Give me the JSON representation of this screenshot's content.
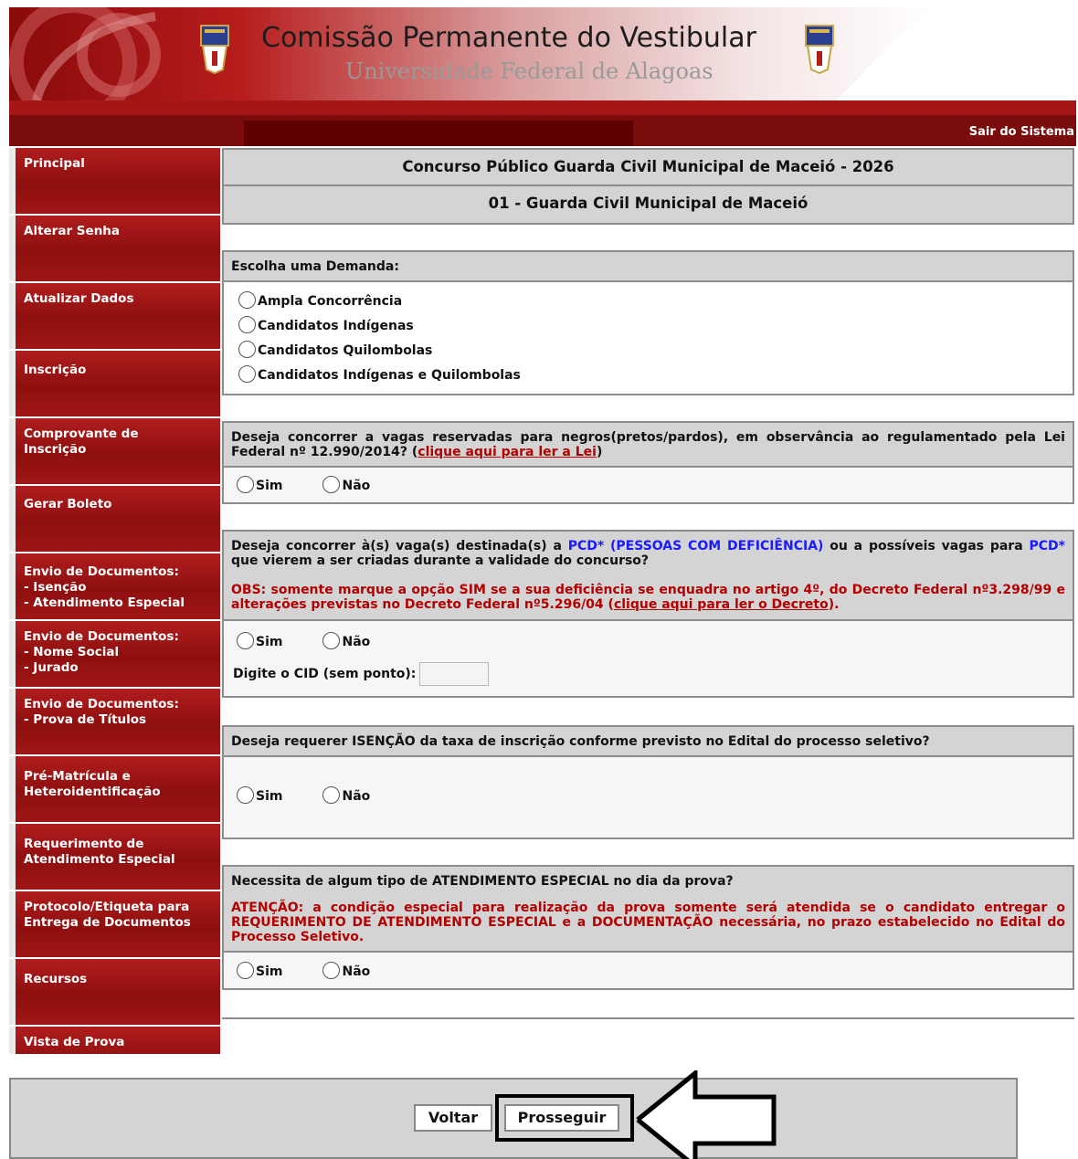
{
  "header": {
    "title": "Comissão Permanente do Vestibular",
    "subtitle": "Universidade Federal de Alagoas",
    "logout_label": "Sair do Sistema",
    "icons": [
      "university-crest-icon"
    ]
  },
  "sidebar": {
    "items": [
      {
        "label": "Principal"
      },
      {
        "label": "Alterar Senha"
      },
      {
        "label": "Atualizar Dados"
      },
      {
        "label": "Inscrição"
      },
      {
        "label": "Comprovante de\nInscrição"
      },
      {
        "label": "Gerar Boleto"
      },
      {
        "label": "Envio de Documentos:\n- Isenção\n- Atendimento Especial"
      },
      {
        "label": "Envio de Documentos:\n- Nome Social\n- Jurado"
      },
      {
        "label": "Envio de Documentos:\n- Prova de Títulos"
      },
      {
        "label": "Pré-Matrícula e\nHeteroidentificação"
      },
      {
        "label": "Requerimento de\nAtendimento Especial"
      },
      {
        "label": "Protocolo/Etiqueta para\nEntrega de Documentos"
      },
      {
        "label": "Recursos"
      },
      {
        "label": "Vista de Prova"
      }
    ]
  },
  "main": {
    "contest_title": "Concurso Público Guarda Civil Municipal de Maceió - 2026",
    "position_title": "01 - Guarda Civil Municipal de Maceió",
    "demand": {
      "heading": "Escolha uma Demanda:",
      "options": [
        "Ampla Concorrência",
        "Candidatos Indígenas",
        "Candidatos Quilombolas",
        "Candidatos Indígenas e Quilombolas"
      ]
    },
    "q_negros": {
      "text": "Deseja concorrer a vagas reservadas para negros(pretos/pardos), em observância ao regulamentado pela Lei Federal nº 12.990/2014? (",
      "link": "clique aqui para ler a Lei",
      "tail": ")",
      "yes": "Sim",
      "no": "Não"
    },
    "q_pcd": {
      "text_a": "Deseja concorrer à(s) vaga(s) destinada(s) a ",
      "pcd_full": "PCD* (PESSOAS COM DEFICIÊNCIA)",
      "text_b": " ou a possíveis vagas para ",
      "pcd_short": "PCD*",
      "text_c": " que vierem a ser criadas durante a validade do concurso?",
      "obs": "OBS: somente marque a opção SIM se a sua deficiência se enquadra no artigo 4º, do Decreto Federal nº3.298/99 e alterações previstas no Decreto Federal nº5.296/04 (",
      "obs_link": "clique aqui para ler o Decreto",
      "obs_tail": ").",
      "yes": "Sim",
      "no": "Não",
      "cid_label": "Digite o CID (sem ponto):",
      "cid_value": ""
    },
    "q_isencao": {
      "text": "Deseja requerer ISENÇÃO da taxa de inscrição conforme previsto no Edital do processo seletivo?",
      "yes": "Sim",
      "no": "Não"
    },
    "q_atendimento": {
      "text": "Necessita de algum tipo de ATENDIMENTO ESPECIAL no dia da prova?",
      "warning": "ATENÇÃO: a condição especial para realização da prova somente será atendida se o candidato entregar o REQUERIMENTO DE ATENDIMENTO ESPECIAL e a DOCUMENTAÇÃO necessária, no prazo estabelecido no Edital do Processo Seletivo.",
      "yes": "Sim",
      "no": "Não"
    }
  },
  "footer": {
    "back_label": "Voltar",
    "next_label": "Prosseguir"
  },
  "colors": {
    "brand_red": "#8e0f0f",
    "alert_red": "#b30000",
    "link_blue": "#1a1aff",
    "panel_gray": "#d4d4d4"
  }
}
